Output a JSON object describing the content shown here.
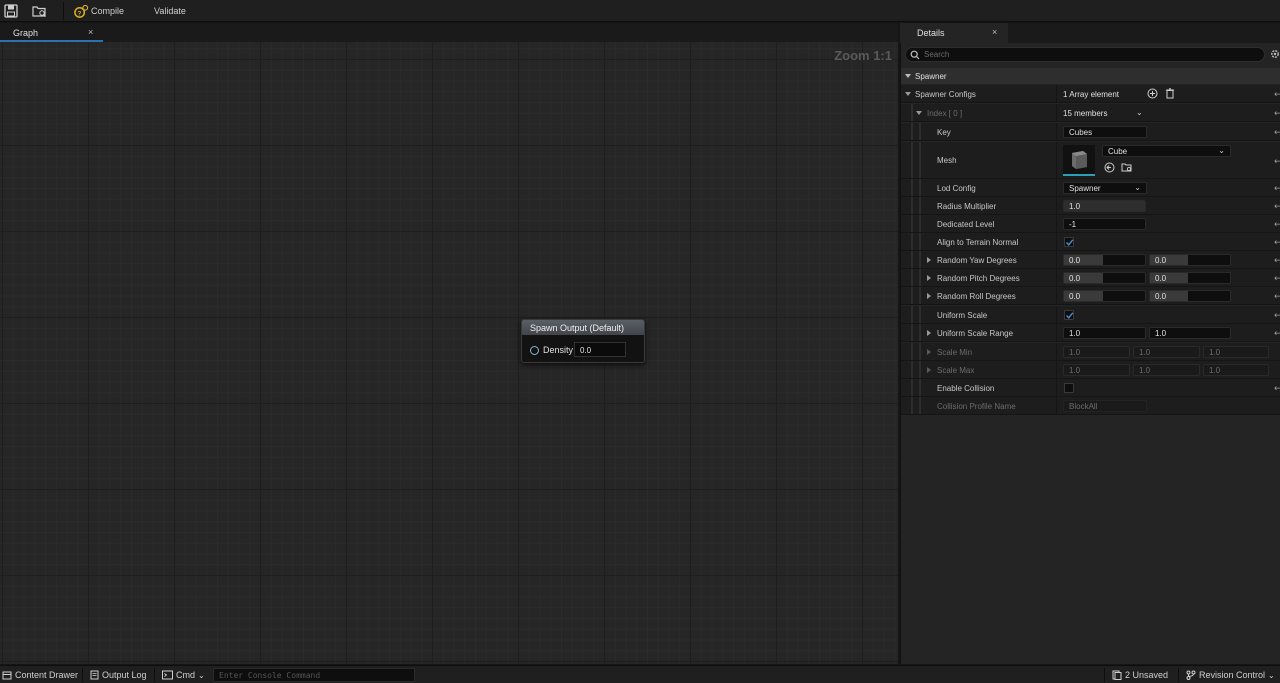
{
  "toolbar": {
    "compile_label": "Compile",
    "validate_label": "Validate"
  },
  "graph_tab": {
    "label": "Graph",
    "close": "×"
  },
  "graph": {
    "zoom": "Zoom 1:1",
    "node": {
      "title": "Spawn Output (Default)",
      "pin_label": "Density",
      "pin_value": "0.0"
    }
  },
  "details_tab": {
    "label": "Details",
    "close": "×"
  },
  "details": {
    "search_placeholder": "Search",
    "category": "Spawner",
    "spawner_configs": {
      "label": "Spawner Configs",
      "value": "1 Array element"
    },
    "index": {
      "label": "Index [ 0 ]",
      "value": "15 members"
    },
    "key": {
      "label": "Key",
      "value": "Cubes"
    },
    "mesh": {
      "label": "Mesh",
      "value": "Cube"
    },
    "lod_config": {
      "label": "Lod Config",
      "value": "Spawner"
    },
    "radius_multiplier": {
      "label": "Radius Multiplier",
      "value": "1.0"
    },
    "dedicated_level": {
      "label": "Dedicated Level",
      "value": "-1"
    },
    "align_to_terrain_normal": {
      "label": "Align to Terrain Normal",
      "checked": true
    },
    "random_yaw": {
      "label": "Random Yaw Degrees",
      "min": "0.0",
      "max": "0.0"
    },
    "random_pitch": {
      "label": "Random Pitch Degrees",
      "min": "0.0",
      "max": "0.0"
    },
    "random_roll": {
      "label": "Random Roll Degrees",
      "min": "0.0",
      "max": "0.0"
    },
    "uniform_scale": {
      "label": "Uniform Scale",
      "checked": true
    },
    "uniform_scale_range": {
      "label": "Uniform Scale Range",
      "min": "1.0",
      "max": "1.0"
    },
    "scale_min": {
      "label": "Scale Min",
      "x": "1.0",
      "y": "1.0",
      "z": "1.0"
    },
    "scale_max": {
      "label": "Scale Max",
      "x": "1.0",
      "y": "1.0",
      "z": "1.0"
    },
    "enable_collision": {
      "label": "Enable Collision",
      "checked": false
    },
    "collision_profile_name": {
      "label": "Collision Profile Name",
      "value": "BlockAll"
    }
  },
  "statusbar": {
    "content_drawer": "Content Drawer",
    "output_log": "Output Log",
    "cmd": "Cmd",
    "console_placeholder": "Enter Console Command",
    "unsaved": "2 Unsaved",
    "revision_control": "Revision Control"
  }
}
